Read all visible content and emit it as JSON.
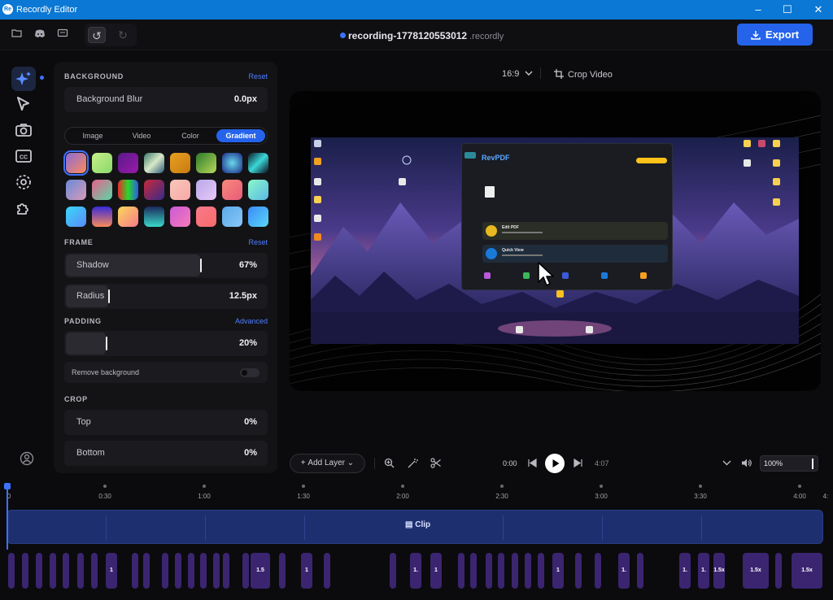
{
  "window": {
    "title": "Recordly Editor",
    "logo_text": "Re"
  },
  "toolbar": {
    "file_name": "recording-1778120553012",
    "file_ext": ".recordly",
    "export_label": "Export"
  },
  "panel": {
    "background": {
      "heading": "BACKGROUND",
      "reset_label": "Reset",
      "blur_label": "Background Blur",
      "blur_value": "0.0px",
      "tabs": [
        "Image",
        "Video",
        "Color",
        "Gradient"
      ],
      "selected_tab": "Gradient",
      "selected_swatch": 0
    },
    "frame": {
      "heading": "FRAME",
      "reset_label": "Reset",
      "shadow_label": "Shadow",
      "shadow_value": "67%",
      "shadow_level": 0.67,
      "radius_label": "Radius",
      "radius_value": "12.5px",
      "radius_level": 0.25
    },
    "padding": {
      "heading": "PADDING",
      "advanced_label": "Advanced",
      "value": "20%",
      "level": 0.2,
      "remove_bg_label": "Remove background",
      "remove_bg_on": false
    },
    "crop": {
      "heading": "CROP",
      "top_label": "Top",
      "top_value": "0%",
      "bottom_label": "Bottom",
      "bottom_value": "0%"
    }
  },
  "preview": {
    "aspect_ratio": "16:9",
    "crop_label": "Crop Video",
    "app_in_recording": "RevPDF",
    "card_1_title": "Edit PDF",
    "card_2_title": "Quick View"
  },
  "playback": {
    "add_layer_label": "Add Layer",
    "current_time": "0:00",
    "total_time": "4:07",
    "zoom_value": "100%",
    "zoom_level": 1.0
  },
  "timeline": {
    "ticks": [
      "0",
      "0:30",
      "1:00",
      "1:30",
      "2:00",
      "2:30",
      "3:00",
      "3:30",
      "4:00",
      "4:"
    ],
    "clip_label": "Clip",
    "zoom_segment_labels": [
      "1",
      "1.5",
      "1",
      "1.",
      "1",
      "1",
      "1.",
      "1.",
      "1.",
      "1.5x",
      "1.5x"
    ]
  },
  "colors": {
    "accent": "#2563eb",
    "titlebar": "#0a78d4",
    "clip": "#1e2f70",
    "segment": "#3b2570"
  }
}
